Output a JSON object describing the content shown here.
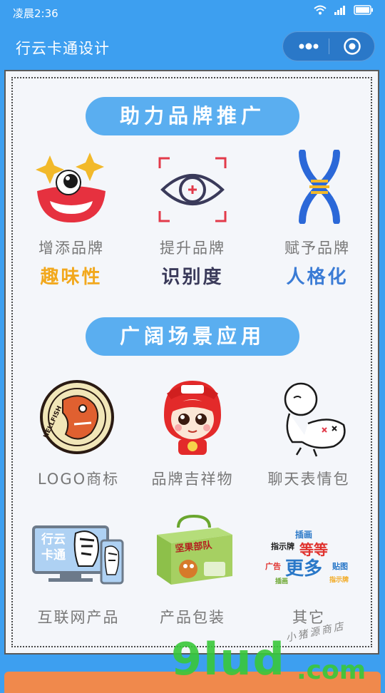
{
  "status": {
    "time": "凌晨2:36"
  },
  "nav": {
    "title": "行云卡通设计"
  },
  "section1": {
    "title": "助力品牌推广"
  },
  "features": [
    {
      "caption": "增添品牌",
      "highlight": "趣味性",
      "color": "#f2a81d",
      "icon": "clown-eye-icon"
    },
    {
      "caption": "提升品牌",
      "highlight": "识别度",
      "color": "#3a3a5a",
      "icon": "eye-focus-icon"
    },
    {
      "caption": "赋予品牌",
      "highlight": "人格化",
      "color": "#3a7bd5",
      "icon": "dna-icon"
    }
  ],
  "section2": {
    "title": "广阔场景应用"
  },
  "scenes": [
    {
      "caption": "LOGO商标",
      "icon": "hellfish-logo-icon",
      "logo_text": "HELLFISH"
    },
    {
      "caption": "品牌吉祥物",
      "icon": "mascot-icon"
    },
    {
      "caption": "聊天表情包",
      "icon": "sticker-icon"
    },
    {
      "caption": "互联网产品",
      "icon": "devices-icon",
      "screen_text": "行云\n卡通"
    },
    {
      "caption": "产品包装",
      "icon": "package-box-icon",
      "box_text": "坚果部队"
    },
    {
      "caption": "其它",
      "icon": "word-cloud-icon",
      "cloud_words": [
        "插画",
        "等等",
        "更多",
        "指示牌",
        "广告",
        "贴图"
      ]
    }
  ],
  "watermark": {
    "main": "9lud",
    "suffix": ".com",
    "note": "小猪源商店"
  },
  "colors": {
    "primary": "#3d9ff0",
    "pill": "#5aaef0",
    "accent_orange": "#f0894c"
  }
}
